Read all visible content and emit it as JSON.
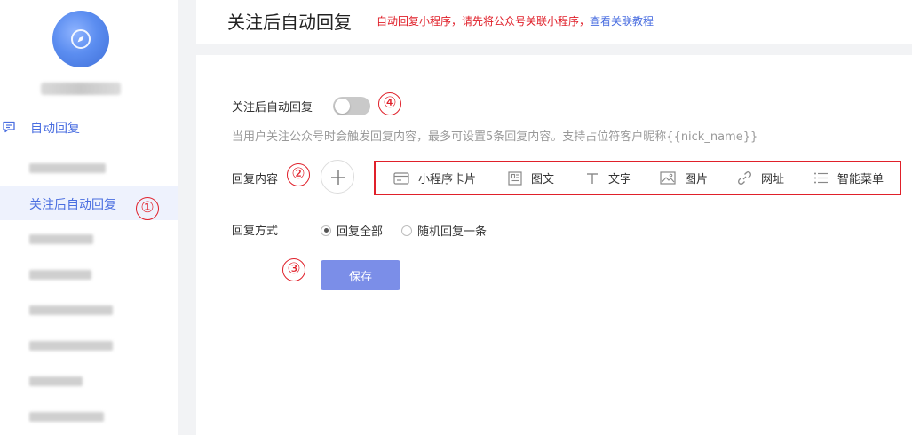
{
  "sidebar": {
    "section_label": "自动回复",
    "active_item_label": "关注后自动回复",
    "blurred_item_widths": [
      86,
      0,
      72,
      70,
      94,
      94,
      60,
      84
    ]
  },
  "header": {
    "title": "关注后自动回复",
    "tip_text": "自动回复小程序，请先将公众号关联小程序，",
    "tip_link": "查看关联教程"
  },
  "main": {
    "follow_reply_label": "关注后自动回复",
    "follow_reply_enabled": false,
    "hint": "当用户关注公众号时会触发回复内容，最多可设置5条回复内容。支持占位符客户昵称{{nick_name}}",
    "reply_content_label": "回复内容",
    "content_types": [
      {
        "label": "小程序卡片",
        "icon": "card-icon"
      },
      {
        "label": "图文",
        "icon": "article-icon"
      },
      {
        "label": "文字",
        "icon": "text-icon"
      },
      {
        "label": "图片",
        "icon": "image-icon"
      },
      {
        "label": "网址",
        "icon": "link-icon"
      },
      {
        "label": "智能菜单",
        "icon": "menu-list-icon"
      }
    ],
    "reply_mode_label": "回复方式",
    "reply_mode_options": [
      "回复全部",
      "随机回复一条"
    ],
    "reply_mode_selected": "回复全部",
    "save_label": "保存"
  },
  "markers": [
    "①",
    "②",
    "③",
    "④"
  ],
  "colors": {
    "accent": "#4a6ee0",
    "annotation_red": "#e0202a",
    "save_button": "#7b8ee8",
    "toggle_off": "#c9c9c9"
  }
}
